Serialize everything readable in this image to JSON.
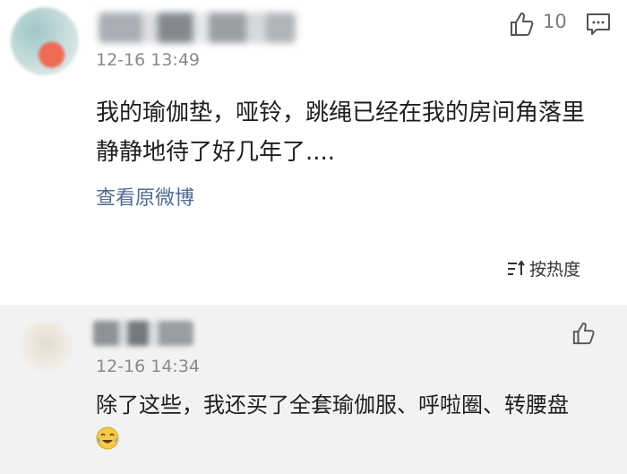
{
  "comment": {
    "time": "12-16 13:49",
    "like_count": "10",
    "text": "我的瑜伽垫，哑铃，跳绳已经在我的房间角落里静静地待了好几年了....",
    "view_original": "查看原微博"
  },
  "sort": {
    "label": "按热度",
    "icon": "sort-icon"
  },
  "reply": {
    "time": "12-16 14:34",
    "text": "除了这些，我还买了全套瑜伽服、呼啦圈、转腰盘",
    "emoji": "laughing-tears-emoji"
  },
  "colors": {
    "link": "#506b94",
    "meta": "#8a8a8a",
    "reply_bg": "#f2f2f2"
  }
}
